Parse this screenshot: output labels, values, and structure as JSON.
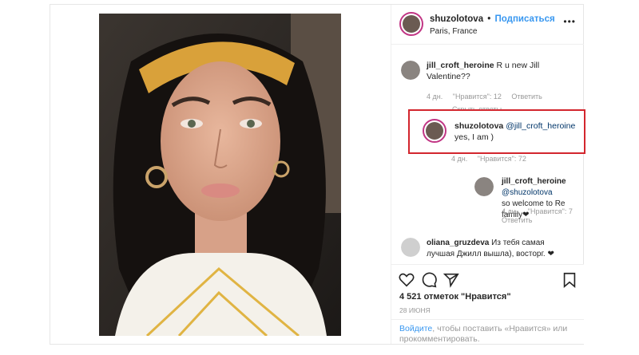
{
  "header": {
    "username": "shuzolotova",
    "dot": "•",
    "follow": "Подписаться",
    "location": "Paris, France",
    "more": "•••"
  },
  "comments": [
    {
      "username": "jill_croft_heroine",
      "text_line1": "R u new Jill",
      "text_line2": "Valentine??",
      "age": "4 дн.",
      "likes": "\"Нравится\": 12",
      "reply": "Ответить",
      "hide_replies": "Скрыть ответы"
    }
  ],
  "replies": [
    {
      "username": "shuzolotova",
      "mention": "@jill_croft_heroine",
      "text": "yes, I am )",
      "age": "4 дн.",
      "likes": "\"Нравится\": 72"
    },
    {
      "username": "jill_croft_heroine",
      "mention": "@shuzolotova",
      "text": "so welcome to Re family❤",
      "age": "4 дн.",
      "likes": "\"Нравится\": 7",
      "reply": "Ответить"
    }
  ],
  "last_comment": {
    "username": "oliana_gruzdeva",
    "text_line1": "Из тебя самая",
    "text_line2": "лучшая Джилл вышла), восторг. ❤"
  },
  "actions": {
    "likes": "4 521 отметок \"Нравится\"",
    "date": "28 июня",
    "login_link": "Войдите",
    "login_text": ", чтобы поставить «Нравится» или прокомментировать."
  },
  "icons": [
    "heart-icon",
    "comment-icon",
    "share-icon",
    "bookmark-icon",
    "more-icon"
  ],
  "colors": {
    "link": "#3897f0",
    "highlight": "#d3262e",
    "meta": "#999999"
  }
}
